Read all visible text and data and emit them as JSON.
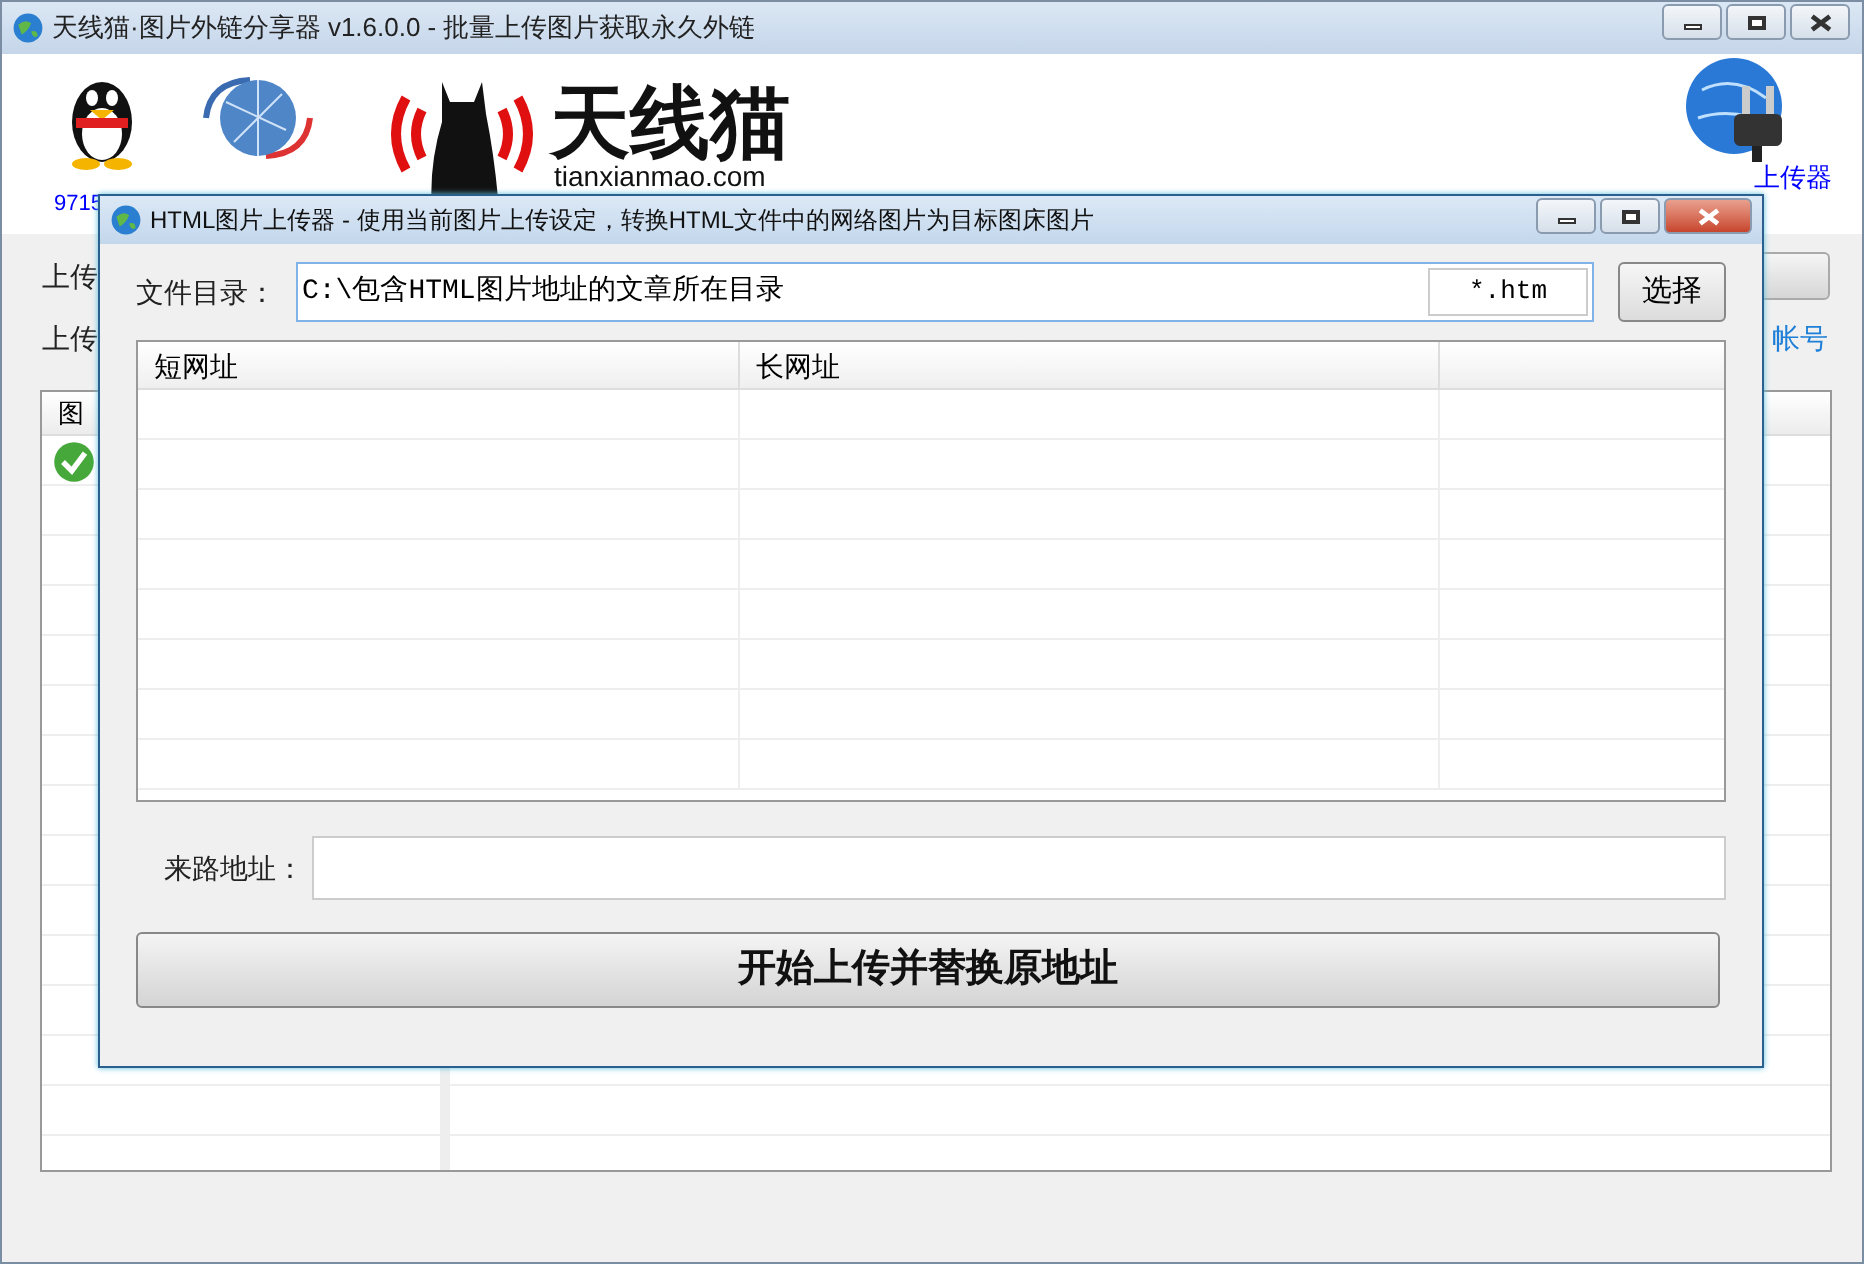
{
  "main_window": {
    "title": "天线猫·图片外链分享器 v1.6.0.0 - 批量上传图片获取永久外链",
    "qq_link": "9715",
    "logo_text": "天线猫",
    "logo_domain": "tianxianmao.com",
    "uploader_link": "上传器",
    "row_labels": [
      "上传",
      "上传"
    ],
    "account_link": "帐号",
    "list_header": "图"
  },
  "dialog": {
    "title": "HTML图片上传器 - 使用当前图片上传设定，转换HTML文件中的网络图片为目标图床图片",
    "dir_label": "文件目录：",
    "dir_value": "C:\\包含HTML图片地址的文章所在目录",
    "filter_value": "*.htm",
    "browse_button": "选择",
    "columns": [
      "短网址",
      "长网址"
    ],
    "referer_label": "来路地址：",
    "start_button": "开始上传并替换原地址"
  }
}
